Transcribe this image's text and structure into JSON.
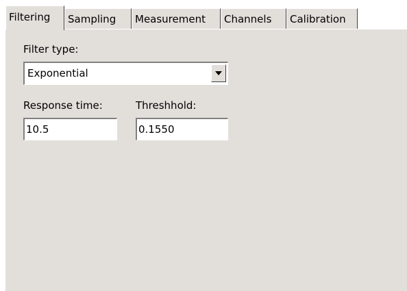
{
  "tabs": [
    {
      "label": "Filtering",
      "active": true
    },
    {
      "label": "Sampling",
      "active": false
    },
    {
      "label": "Measurement",
      "active": false
    },
    {
      "label": "Channels",
      "active": false
    },
    {
      "label": "Calibration",
      "active": false
    }
  ],
  "filtering": {
    "filter_type_label": "Filter type:",
    "filter_type_value": "Exponential",
    "response_time_label": "Response time:",
    "response_time_value": "10.5",
    "threshold_label": "Threshhold:",
    "threshold_value": "0.1550"
  },
  "icons": {
    "dropdown": "chevron-down-icon"
  },
  "colors": {
    "panel_background": "#e2dfdb",
    "page_background": "#ffffff"
  }
}
